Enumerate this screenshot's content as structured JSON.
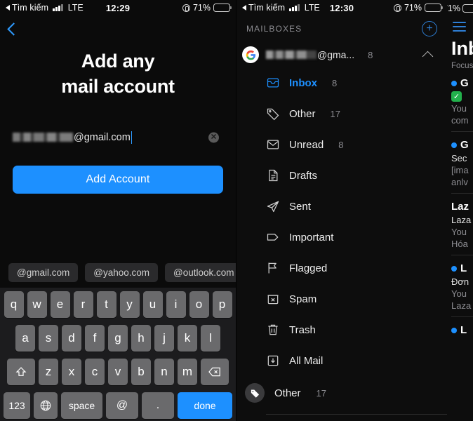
{
  "status_bar_left": {
    "back_label": "Tìm kiếm",
    "network": "LTE",
    "time_left": "12:29",
    "time_middle": "12:30",
    "battery_pct": "71%"
  },
  "add_account_panel": {
    "back_icon": "chevron-left-icon",
    "title_line1": "Add any",
    "title_line2": "mail account",
    "email_input": {
      "value_visible": "@gmail.com",
      "redacted_prefix": true,
      "clear_icon": "clear-circle-icon"
    },
    "submit_label": "Add Account",
    "suggestions": [
      "@gmail.com",
      "@yahoo.com",
      "@outlook.com"
    ],
    "keyboard": {
      "row1": [
        "q",
        "w",
        "e",
        "r",
        "t",
        "y",
        "u",
        "i",
        "o",
        "p"
      ],
      "row2": [
        "a",
        "s",
        "d",
        "f",
        "g",
        "h",
        "j",
        "k",
        "l"
      ],
      "row3": [
        "z",
        "x",
        "c",
        "v",
        "b",
        "n",
        "m"
      ],
      "shift_icon": "shift-arrow-icon",
      "backspace_icon": "backspace-icon",
      "numbers_label": "123",
      "globe_icon": "globe-icon",
      "space_label": "space",
      "at_label": "@",
      "dot_label": ".",
      "done_label": "done"
    }
  },
  "mailboxes_panel": {
    "header_title": "MAILBOXES",
    "add_icon": "plus-circle-icon",
    "account": {
      "provider_icon": "google-g-icon",
      "email_visible": "@gma...",
      "redacted_prefix": true,
      "count": "8",
      "collapse_icon": "chevron-up-icon"
    },
    "items": [
      {
        "label": "Inbox",
        "count": "8",
        "icon": "inbox-tray-icon",
        "active": true
      },
      {
        "label": "Other",
        "count": "17",
        "icon": "tag-icon",
        "active": false
      },
      {
        "label": "Unread",
        "count": "8",
        "icon": "envelope-icon",
        "active": false
      },
      {
        "label": "Drafts",
        "count": "",
        "icon": "document-icon",
        "active": false
      },
      {
        "label": "Sent",
        "count": "",
        "icon": "paper-plane-icon",
        "active": false
      },
      {
        "label": "Important",
        "count": "",
        "icon": "label-tag-icon",
        "active": false
      },
      {
        "label": "Flagged",
        "count": "",
        "icon": "flag-icon",
        "active": false
      },
      {
        "label": "Spam",
        "count": "",
        "icon": "spam-box-icon",
        "active": false
      },
      {
        "label": "Trash",
        "count": "",
        "icon": "trash-icon",
        "active": false
      },
      {
        "label": "All Mail",
        "count": "",
        "icon": "archive-down-icon",
        "active": false
      }
    ],
    "footer_item": {
      "label": "Other",
      "count": "17",
      "icon": "tag-filled-icon"
    }
  },
  "inbox_panel": {
    "menu_icon": "hamburger-menu-icon",
    "title": "Inb",
    "subtitle": "Focuse",
    "messages": [
      {
        "unread": true,
        "sender": "G",
        "badge_icon": "green-check-icon",
        "line2": "",
        "line3": "You",
        "line4": "com"
      },
      {
        "unread": true,
        "sender": "G",
        "badge_icon": "",
        "line2": "Sec",
        "line3": "[ima",
        "line4": "anlv"
      },
      {
        "unread": false,
        "sender": "Laz",
        "badge_icon": "",
        "line2": "Laza",
        "line3": "You",
        "line4": "Hóa"
      },
      {
        "unread": true,
        "sender": "L",
        "badge_icon": "",
        "line2": "Đơn",
        "line3": "You",
        "line4": "Laza"
      },
      {
        "unread": true,
        "sender": "L",
        "badge_icon": "",
        "line2": "",
        "line3": "",
        "line4": ""
      }
    ]
  },
  "colors": {
    "accent_blue": "#1d90ff",
    "muted_gray": "#8d8d92",
    "panel_bg": "#0d0d0d",
    "key_gray": "#6a6a6c",
    "green": "#22b14c"
  }
}
